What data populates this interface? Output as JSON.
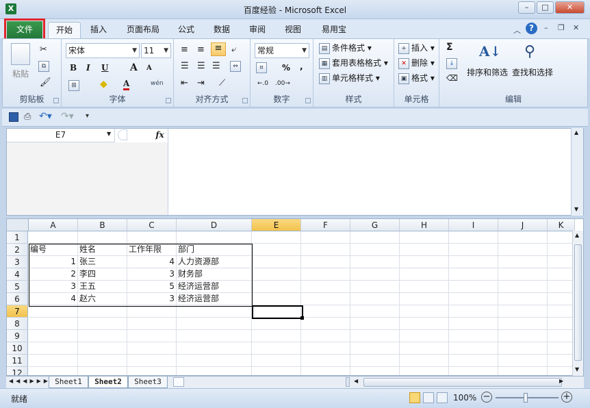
{
  "window": {
    "title": "百度经验 - Microsoft Excel",
    "app_icon": "X"
  },
  "menu_tabs": [
    "文件",
    "开始",
    "插入",
    "页面布局",
    "公式",
    "数据",
    "审阅",
    "视图",
    "易用宝"
  ],
  "ribbon": {
    "clipboard": {
      "label": "剪贴板",
      "paste": "粘贴"
    },
    "font": {
      "label": "字体",
      "font_name": "宋体",
      "font_size": "11",
      "bold": "B",
      "italic": "I",
      "underline": "U",
      "grow": "A",
      "shrink": "A",
      "color_a": "A",
      "wen": "wén"
    },
    "align": {
      "label": "对齐方式"
    },
    "number": {
      "label": "数字",
      "format": "常规",
      "percent": "%",
      "comma": ","
    },
    "styles": {
      "label": "样式",
      "cond": "条件格式",
      "table": "套用表格格式",
      "cell": "单元格样式"
    },
    "cells": {
      "label": "单元格",
      "insert": "插入",
      "delete": "删除",
      "format": "格式"
    },
    "editing": {
      "label": "编辑",
      "sort": "排序和筛选",
      "find": "查找和选择",
      "sigma": "Σ"
    }
  },
  "namebox": "E7",
  "fx": "fx",
  "columns": [
    "A",
    "B",
    "C",
    "D",
    "E",
    "F",
    "G",
    "H",
    "I",
    "J",
    "K"
  ],
  "rows": [
    "1",
    "2",
    "3",
    "4",
    "5",
    "6",
    "7",
    "8",
    "9",
    "10",
    "11",
    "12"
  ],
  "table": {
    "header": [
      "编号",
      "姓名",
      "工作年限",
      "部门"
    ],
    "rows": [
      [
        "1",
        "张三",
        "4",
        "人力资源部"
      ],
      [
        "2",
        "李四",
        "3",
        "财务部"
      ],
      [
        "3",
        "王五",
        "5",
        "经济运营部"
      ],
      [
        "4",
        "赵六",
        "3",
        "经济运营部"
      ]
    ]
  },
  "sheet_tabs": [
    "Sheet1",
    "Sheet2",
    "Sheet3"
  ],
  "active_sheet": "Sheet2",
  "status": {
    "ready": "就绪",
    "zoom": "100%"
  }
}
